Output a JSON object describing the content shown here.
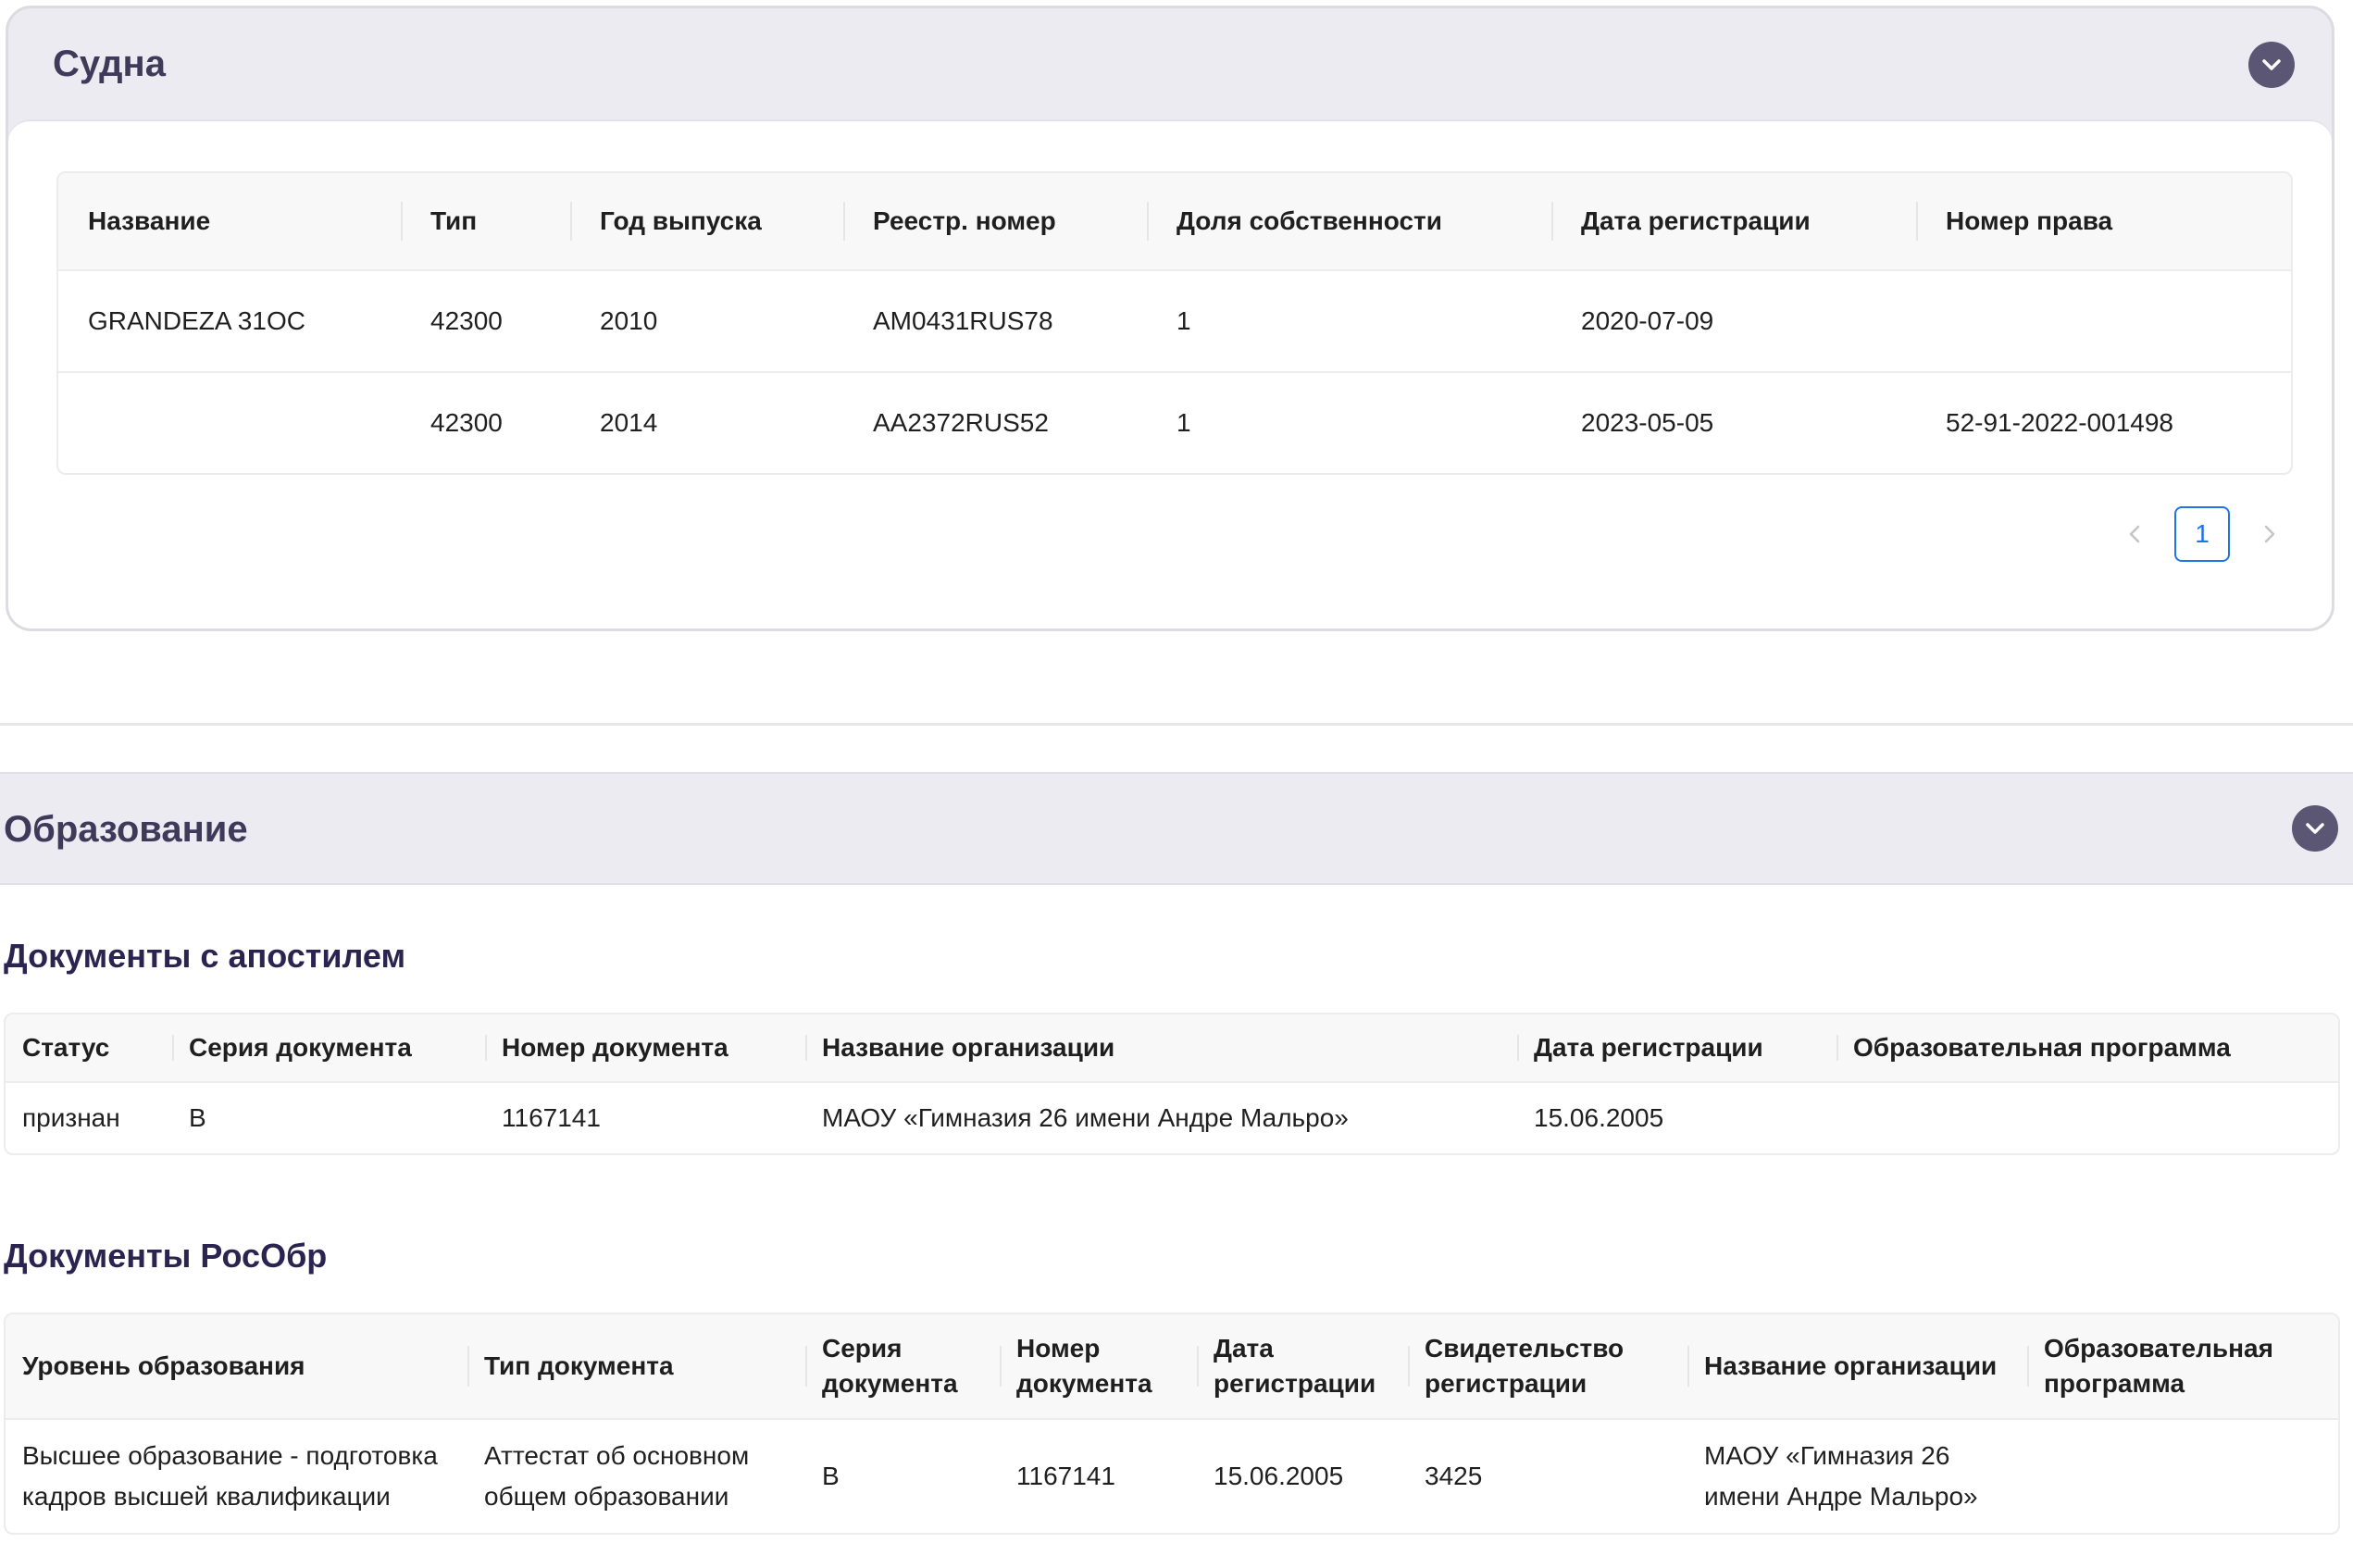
{
  "vessels": {
    "title": "Судна",
    "columns": [
      "Название",
      "Тип",
      "Год выпуска",
      "Реестр. номер",
      "Доля собственности",
      "Дата регистрации",
      "Номер права"
    ],
    "rows": [
      [
        "GRANDEZA 31OC",
        "42300",
        "2010",
        "AM0431RUS78",
        "1",
        "2020-07-09",
        ""
      ],
      [
        "",
        "42300",
        "2014",
        "AA2372RUS52",
        "1",
        "2023-05-05",
        "52-91-2022-001498"
      ]
    ],
    "pagination": {
      "current_page": "1"
    }
  },
  "education": {
    "title": "Образование",
    "apostille": {
      "title": "Документы с апостилем",
      "columns": [
        "Статус",
        "Серия документа",
        "Номер документа",
        "Название организации",
        "Дата регистрации",
        "Образовательная программа"
      ],
      "rows": [
        [
          "признан",
          "B",
          "1167141",
          "МАОУ «Гимназия 26 имени Андре Мальро»",
          "15.06.2005",
          ""
        ]
      ]
    },
    "rosobr": {
      "title": "Документы РосОбр",
      "columns": [
        "Уровень образования",
        "Тип документа",
        "Серия документа",
        "Номер документа",
        "Дата регистрации",
        "Свидетельство регистрации",
        "Название организации",
        "Образовательная программа"
      ],
      "rows": [
        [
          "Высшее образование - подготовка кадров высшей квалификации",
          "Аттестат об основном общем образовании",
          "B",
          "1167141",
          "15.06.2005",
          "3425",
          "МАОУ «Гимназия 26 имени Андре Мальро»",
          ""
        ]
      ]
    }
  },
  "colors": {
    "header_bg": "#ecebf1",
    "title": "#3f3a5a",
    "toggle": "#5a5673",
    "accent": "#1f74e8"
  },
  "icons": [
    "chevron-down-icon",
    "chevron-left-icon",
    "chevron-right-icon"
  ]
}
